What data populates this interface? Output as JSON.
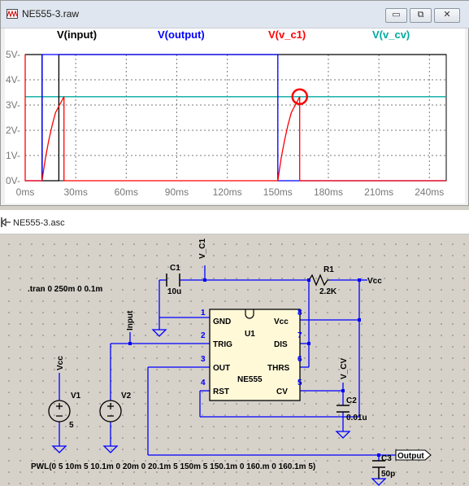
{
  "waveform_window": {
    "title": "NE555-3.raw",
    "buttons": {
      "minimize": "▭",
      "restore": "⧉",
      "close": "✕"
    },
    "trace_labels": [
      {
        "text": "V(input)",
        "color": "#000000"
      },
      {
        "text": "V(output)",
        "color": "#0000ff"
      },
      {
        "text": "V(v_c1)",
        "color": "#ff0000"
      },
      {
        "text": "V(v_cv)",
        "color": "#00a8a0"
      }
    ]
  },
  "chart_data": {
    "type": "line",
    "xlim": [
      0,
      250
    ],
    "ylim": [
      0,
      5
    ],
    "x_ticks": [
      "0ms",
      "30ms",
      "60ms",
      "90ms",
      "120ms",
      "150ms",
      "180ms",
      "210ms",
      "240ms"
    ],
    "y_ticks": [
      "0V-",
      "1V-",
      "2V-",
      "3V-",
      "4V-",
      "5V-"
    ],
    "grid": true,
    "series": [
      {
        "name": "V(input)",
        "color": "#000000",
        "points": [
          [
            0,
            5
          ],
          [
            10,
            5
          ],
          [
            10,
            0
          ],
          [
            20,
            0
          ],
          [
            20,
            5
          ],
          [
            250,
            5
          ]
        ]
      },
      {
        "name": "V(output)",
        "color": "#0000ff",
        "points": [
          [
            0,
            0
          ],
          [
            10.1,
            0
          ],
          [
            10.1,
            5
          ],
          [
            150,
            5
          ],
          [
            150,
            0
          ],
          [
            250,
            0
          ]
        ]
      },
      {
        "name": "V(v_c1)",
        "color": "#ff0000",
        "points": [
          [
            0,
            5
          ],
          [
            0,
            0
          ],
          [
            10,
            0
          ],
          [
            12,
            0.9
          ],
          [
            14,
            1.6
          ],
          [
            16,
            2.2
          ],
          [
            18,
            2.7
          ],
          [
            20,
            2.95
          ],
          [
            22,
            3.2
          ],
          [
            23,
            3.33
          ],
          [
            23,
            0
          ],
          [
            150,
            0
          ],
          [
            152,
            0.9
          ],
          [
            154,
            1.6
          ],
          [
            156,
            2.2
          ],
          [
            158,
            2.7
          ],
          [
            160,
            2.95
          ],
          [
            162,
            3.2
          ],
          [
            163,
            3.33
          ],
          [
            163,
            0
          ],
          [
            250,
            0
          ]
        ]
      },
      {
        "name": "V(v_cv)",
        "color": "#00a8a0",
        "points": [
          [
            0,
            3.33
          ],
          [
            250,
            3.33
          ]
        ]
      }
    ],
    "annotations": [
      {
        "type": "cursor-circle",
        "x": 163,
        "y": 3.33,
        "color": "#ff0000"
      }
    ]
  },
  "schematic_window": {
    "title": "NE555-3.asc",
    "directive": ".tran 0 250m 0 0.1m",
    "pwl": "PWL(0 5 10m 5 10.1m 0 20m 0 20.1m 5 150m 5 150.1m 0 160.m 0 160.1m 5)",
    "labels": {
      "v_c1": "V_C1",
      "c1": "C1",
      "c1_val": "10u",
      "r1": "R1",
      "r1_val": "2.2K",
      "vcc_net": "Vcc",
      "input_net": "Input",
      "vcc_v1": "Vcc",
      "v1": "V1",
      "v1_val": "5",
      "v2": "V2",
      "u1": "U1",
      "u1_part": "NE555",
      "pin_gnd": "GND",
      "pin_trig": "TRIG",
      "pin_out": "OUT",
      "pin_rst": "RST",
      "pin_vcc": "Vcc",
      "pin_dis": "DIS",
      "pin_thrs": "THRS",
      "pin_cv": "CV",
      "n1": "1",
      "n2": "2",
      "n3": "3",
      "n4": "4",
      "n5": "5",
      "n6": "6",
      "n7": "7",
      "n8": "8",
      "v_cv": "V_CV",
      "c2": "C2",
      "c2_val": "0.01u",
      "c3": "C3",
      "c3_val": "50p",
      "output_net": "Output"
    }
  }
}
